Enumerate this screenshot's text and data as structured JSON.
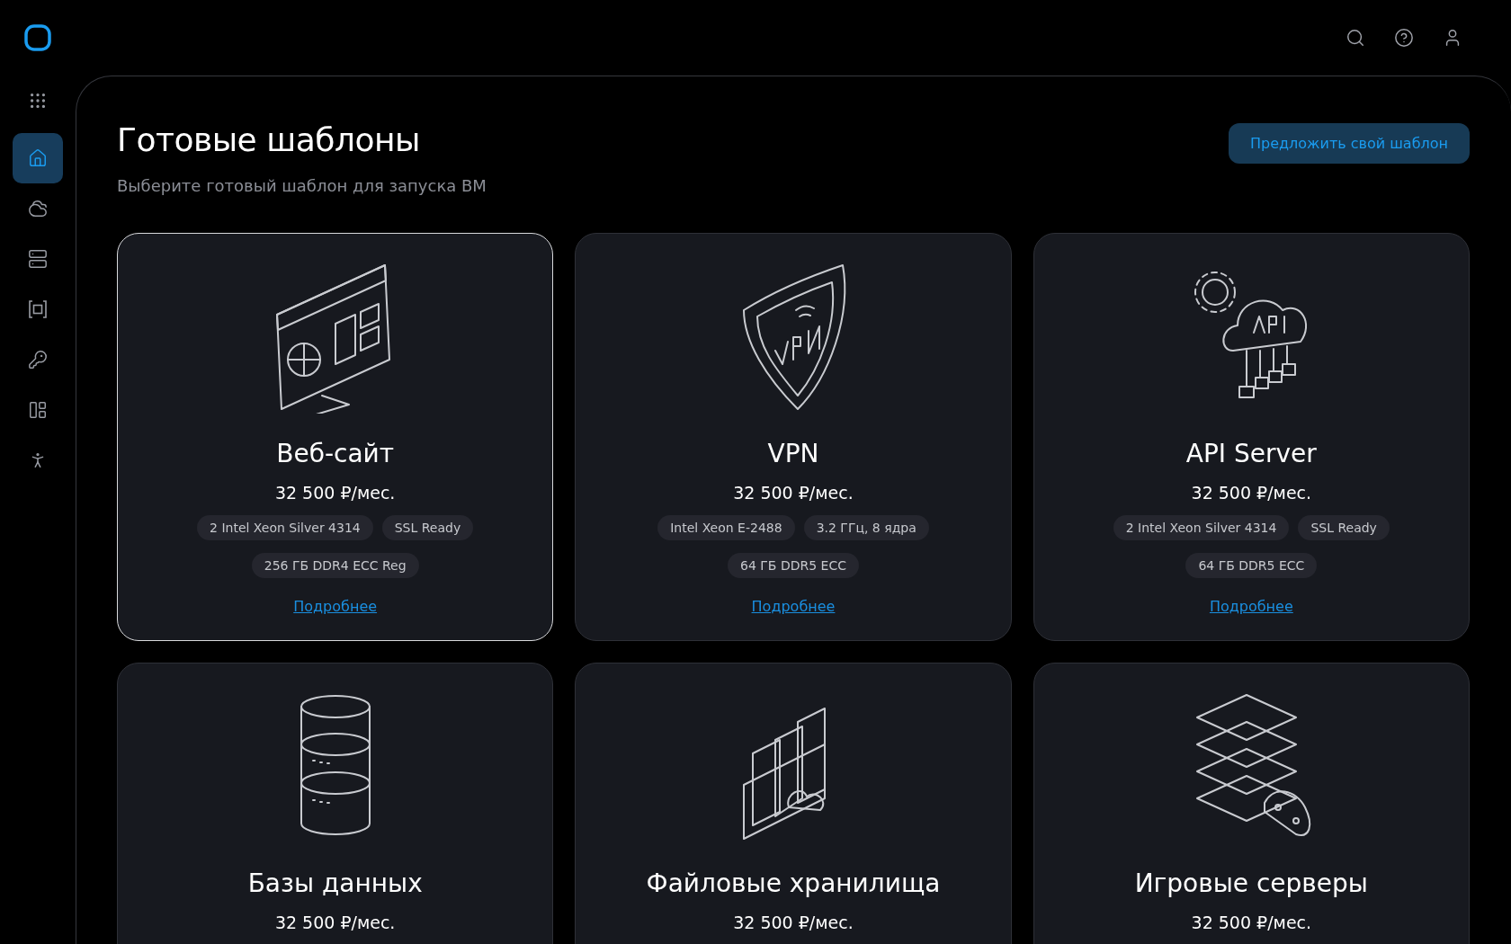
{
  "sidebar": {
    "items": [
      {
        "kind": "apps",
        "selected": false
      },
      {
        "kind": "home",
        "selected": true
      },
      {
        "kind": "cloud",
        "selected": false
      },
      {
        "kind": "servers",
        "selected": false
      },
      {
        "kind": "frame",
        "selected": false
      },
      {
        "kind": "key",
        "selected": false
      },
      {
        "kind": "layout",
        "selected": false
      },
      {
        "kind": "person",
        "selected": false
      }
    ]
  },
  "page": {
    "title": "Готовые шаблоны",
    "subtitle": "Выберите готовый шаблон для запуска ВМ",
    "action": "Предложить свой шаблон"
  },
  "templates": [
    {
      "kind": "monitor",
      "selected": true,
      "title": "Веб-сайт",
      "price": "32 500 ₽/мес.",
      "tags": [
        "2 Intel Xeon Silver 4314",
        "SSL Ready",
        "256 ГБ DDR4 ECC Reg"
      ],
      "link": "Подробнее"
    },
    {
      "kind": "shield",
      "selected": false,
      "title": "VPN",
      "price": "32 500 ₽/мес.",
      "tags": [
        "Intel Xeon E-2488",
        "3.2 ГГц, 8 ядра",
        "64 ГБ DDR5 ECC"
      ],
      "link": "Подробнее"
    },
    {
      "kind": "cloud",
      "selected": false,
      "title": "API Server",
      "price": "32 500 ₽/мес.",
      "tags": [
        "2 Intel Xeon Silver 4314",
        "SSL Ready",
        "64 ГБ DDR5 ECC"
      ],
      "link": "Подробнее"
    },
    {
      "kind": "database",
      "selected": false,
      "title": "Базы данных",
      "price": "32 500 ₽/мес."
    },
    {
      "kind": "folders",
      "selected": false,
      "title": "Файловые хранилища",
      "price": "32 500 ₽/мес."
    },
    {
      "kind": "gamepad",
      "selected": false,
      "title": "Игровые серверы",
      "price": "32 500 ₽/мес."
    }
  ]
}
